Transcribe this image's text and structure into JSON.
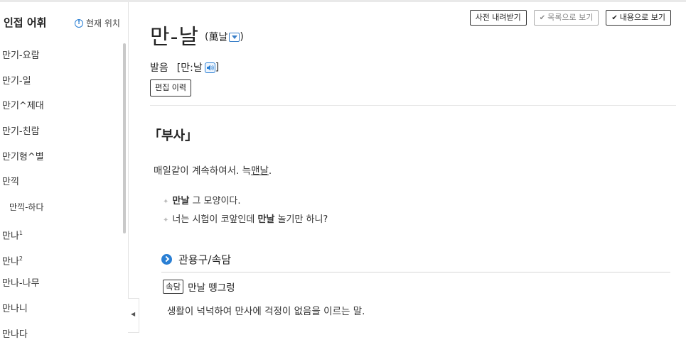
{
  "sidebar": {
    "title": "인접 어휘",
    "current_position": "현재 위치",
    "items": [
      {
        "label": "만기-요람",
        "sup": ""
      },
      {
        "label": "만기-일",
        "sup": ""
      },
      {
        "label": "만기^제대",
        "sup": ""
      },
      {
        "label": "만기-친람",
        "sup": ""
      },
      {
        "label": "만기형^별",
        "sup": ""
      },
      {
        "label": "만끽",
        "sup": ""
      },
      {
        "label": "만끽-하다",
        "sup": "",
        "sub": true
      },
      {
        "label": "만나",
        "sup": "1"
      },
      {
        "label": "만나",
        "sup": "2"
      },
      {
        "label": "만나-나무",
        "sup": ""
      },
      {
        "label": "만나니",
        "sup": ""
      },
      {
        "label": "만나다",
        "sup": ""
      }
    ]
  },
  "toolbar": {
    "download_label": "사전 내려받기",
    "list_view_label": "목록으로 보기",
    "content_view_label": "내용으로 보기"
  },
  "entry": {
    "headword": "만-날",
    "hanja": "萬날",
    "pronunciation_label": "발음",
    "pronunciation": "[만:날",
    "pronunciation_close": "]",
    "edit_history_label": "편집 이력",
    "part_of_speech": "「부사」",
    "definition_text": "매일같이 계속하여서. ",
    "definition_link_prefix": "늑",
    "definition_link": "맨날",
    "definition_end": ".",
    "examples": [
      {
        "bold": "만날",
        "rest": " 그 모양이다.",
        "pre": ""
      },
      {
        "pre": "너는 시험이 코앞인데 ",
        "bold": "만날",
        "rest": " 놀기만 하니?"
      }
    ],
    "idiom_section_title": "관용구/속담",
    "proverb_tag": "속담",
    "proverb": "만날 뗑그렁",
    "proverb_definition": "생활이 넉넉하여 만사에 걱정이 없음을 이르는 말."
  },
  "colors": {
    "accent": "#2a7fd4"
  }
}
